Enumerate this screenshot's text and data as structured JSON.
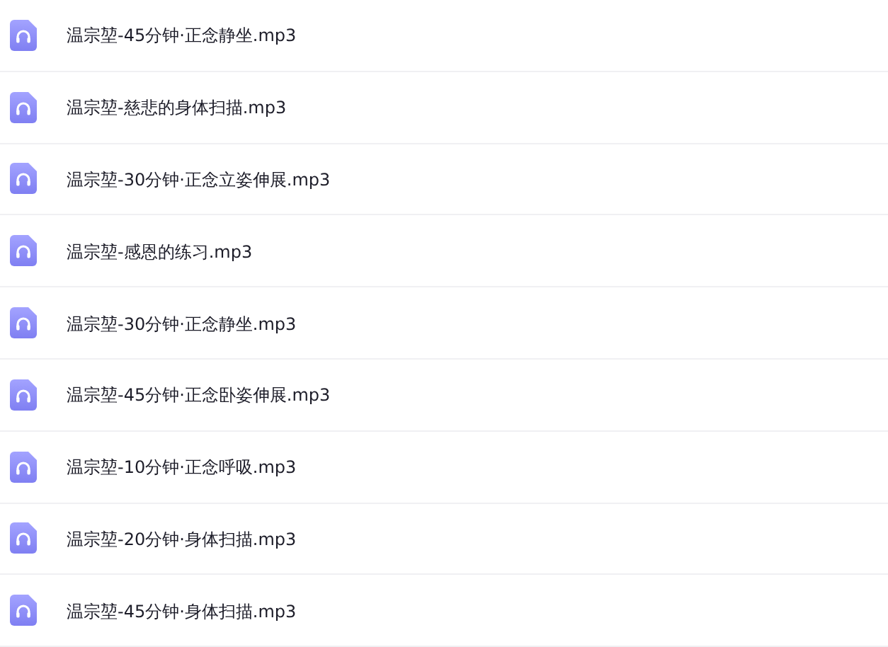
{
  "files": [
    {
      "name": "温宗堃-45分钟·正念静坐.mp3"
    },
    {
      "name": "温宗堃-慈悲的身体扫描.mp3"
    },
    {
      "name": "温宗堃-30分钟·正念立姿伸展.mp3"
    },
    {
      "name": "温宗堃-感恩的练习.mp3"
    },
    {
      "name": "温宗堃-30分钟·正念静坐.mp3"
    },
    {
      "name": "温宗堃-45分钟·正念卧姿伸展.mp3"
    },
    {
      "name": "温宗堃-10分钟·正念呼吸.mp3"
    },
    {
      "name": "温宗堃-20分钟·身体扫描.mp3"
    },
    {
      "name": "温宗堃-45分钟·身体扫描.mp3"
    }
  ]
}
